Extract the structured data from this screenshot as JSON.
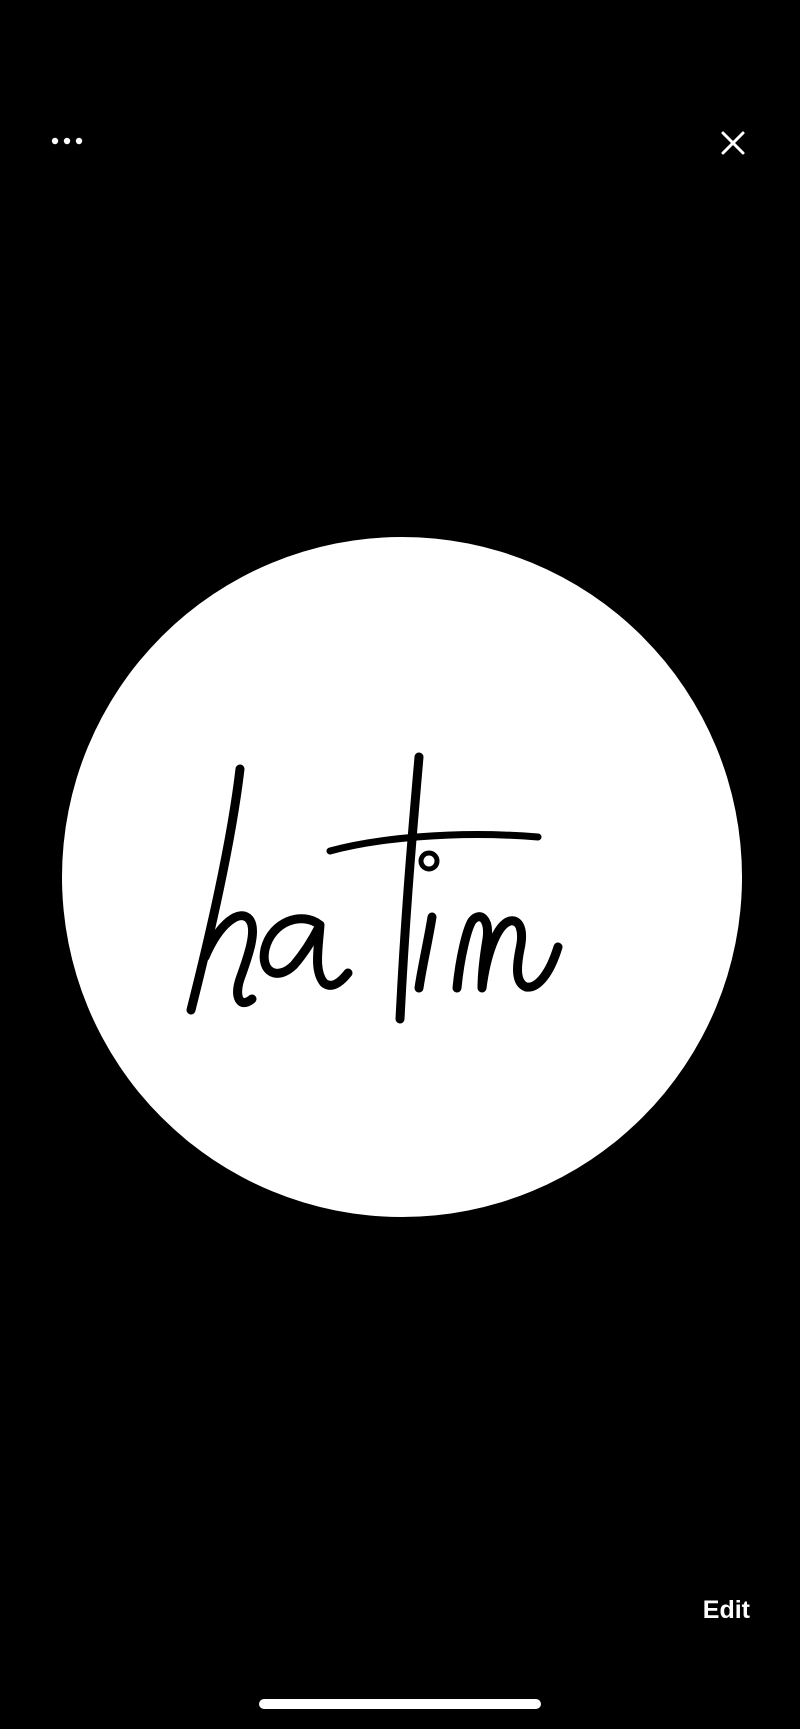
{
  "toolbar": {
    "more_icon": "ellipsis-icon",
    "close_icon": "close-icon"
  },
  "photo": {
    "logo_text": "hatim",
    "shape": "circle",
    "background_color": "#ffffff",
    "ink_color": "#000000"
  },
  "actions": {
    "edit_label": "Edit"
  },
  "colors": {
    "page_background": "#000000",
    "foreground": "#ffffff"
  }
}
